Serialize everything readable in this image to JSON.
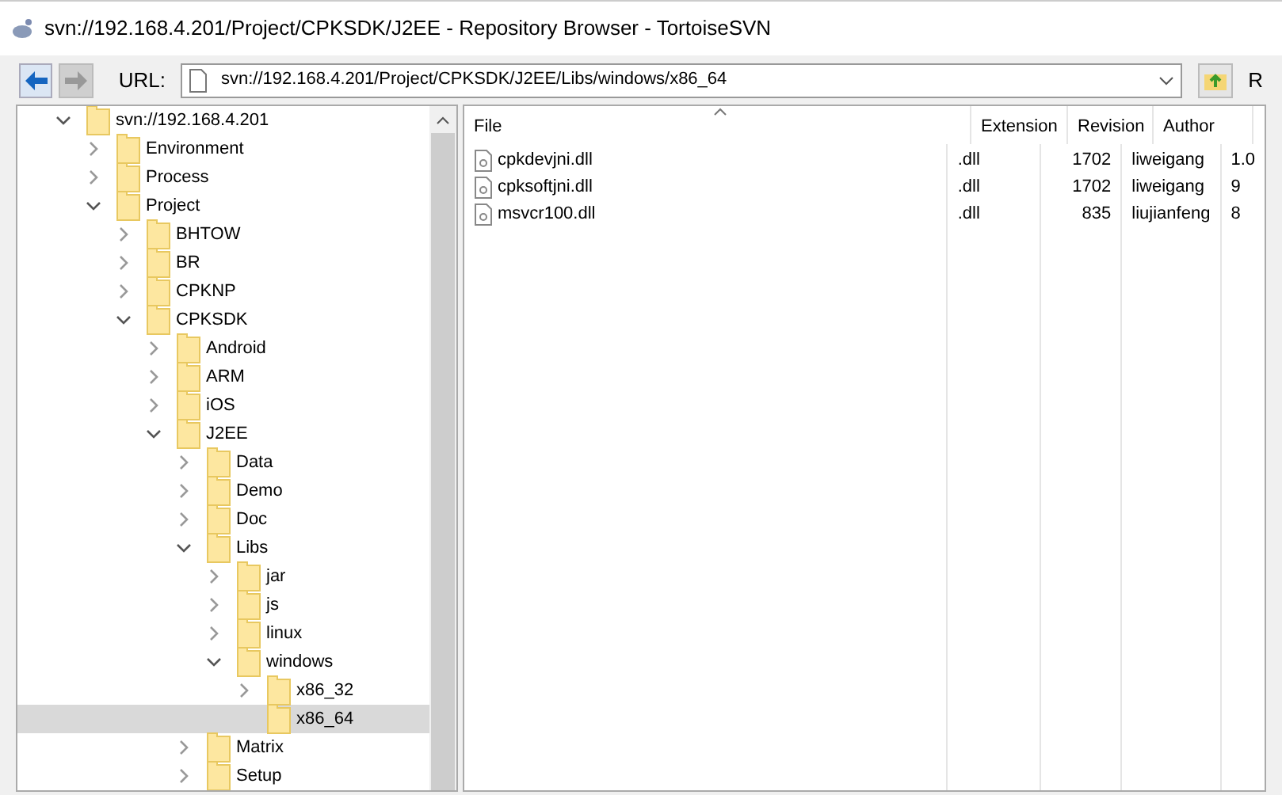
{
  "window": {
    "title": "svn://192.168.4.201/Project/CPKSDK/J2EE - Repository Browser - TortoiseSVN"
  },
  "toolbar": {
    "url_label": "URL:",
    "url": "svn://192.168.4.201/Project/CPKSDK/J2EE/Libs/windows/x86_64",
    "button_partial": "R"
  },
  "tree": [
    {
      "label": "svn://192.168.4.201",
      "expandable": true,
      "expanded": true,
      "selected": false,
      "children": [
        {
          "label": "Environment",
          "expandable": true,
          "expanded": false,
          "selected": false
        },
        {
          "label": "Process",
          "expandable": true,
          "expanded": false,
          "selected": false
        },
        {
          "label": "Project",
          "expandable": true,
          "expanded": true,
          "selected": false,
          "children": [
            {
              "label": "BHTOW",
              "expandable": true,
              "expanded": false,
              "selected": false
            },
            {
              "label": "BR",
              "expandable": true,
              "expanded": false,
              "selected": false
            },
            {
              "label": "CPKNP",
              "expandable": true,
              "expanded": false,
              "selected": false
            },
            {
              "label": "CPKSDK",
              "expandable": true,
              "expanded": true,
              "selected": false,
              "children": [
                {
                  "label": "Android",
                  "expandable": true,
                  "expanded": false,
                  "selected": false
                },
                {
                  "label": "ARM",
                  "expandable": true,
                  "expanded": false,
                  "selected": false
                },
                {
                  "label": "iOS",
                  "expandable": true,
                  "expanded": false,
                  "selected": false
                },
                {
                  "label": "J2EE",
                  "expandable": true,
                  "expanded": true,
                  "selected": false,
                  "children": [
                    {
                      "label": "Data",
                      "expandable": true,
                      "expanded": false,
                      "selected": false
                    },
                    {
                      "label": "Demo",
                      "expandable": true,
                      "expanded": false,
                      "selected": false
                    },
                    {
                      "label": "Doc",
                      "expandable": true,
                      "expanded": false,
                      "selected": false
                    },
                    {
                      "label": "Libs",
                      "expandable": true,
                      "expanded": true,
                      "selected": false,
                      "children": [
                        {
                          "label": "jar",
                          "expandable": true,
                          "expanded": false,
                          "selected": false
                        },
                        {
                          "label": "js",
                          "expandable": true,
                          "expanded": false,
                          "selected": false
                        },
                        {
                          "label": "linux",
                          "expandable": true,
                          "expanded": false,
                          "selected": false
                        },
                        {
                          "label": "windows",
                          "expandable": true,
                          "expanded": true,
                          "selected": false,
                          "children": [
                            {
                              "label": "x86_32",
                              "expandable": true,
                              "expanded": false,
                              "selected": false
                            },
                            {
                              "label": "x86_64",
                              "expandable": false,
                              "expanded": false,
                              "selected": true
                            }
                          ]
                        }
                      ]
                    },
                    {
                      "label": "Matrix",
                      "expandable": true,
                      "expanded": false,
                      "selected": false
                    },
                    {
                      "label": "Setup",
                      "expandable": true,
                      "expanded": false,
                      "selected": false
                    }
                  ]
                }
              ]
            }
          ]
        }
      ]
    }
  ],
  "table": {
    "columns": [
      "File",
      "Extension",
      "Revision",
      "Author"
    ],
    "rows": [
      {
        "file": "cpkdevjni.dll",
        "extension": ".dll",
        "revision": "1702",
        "author": "liweigang",
        "column_5": "1.0"
      },
      {
        "file": "cpksoftjni.dll",
        "extension": ".dll",
        "revision": "1702",
        "author": "liweigang",
        "column_5": "9"
      },
      {
        "file": "msvcr100.dll",
        "extension": ".dll",
        "revision": "835",
        "author": "liujianfeng",
        "column_5": "8"
      }
    ]
  }
}
